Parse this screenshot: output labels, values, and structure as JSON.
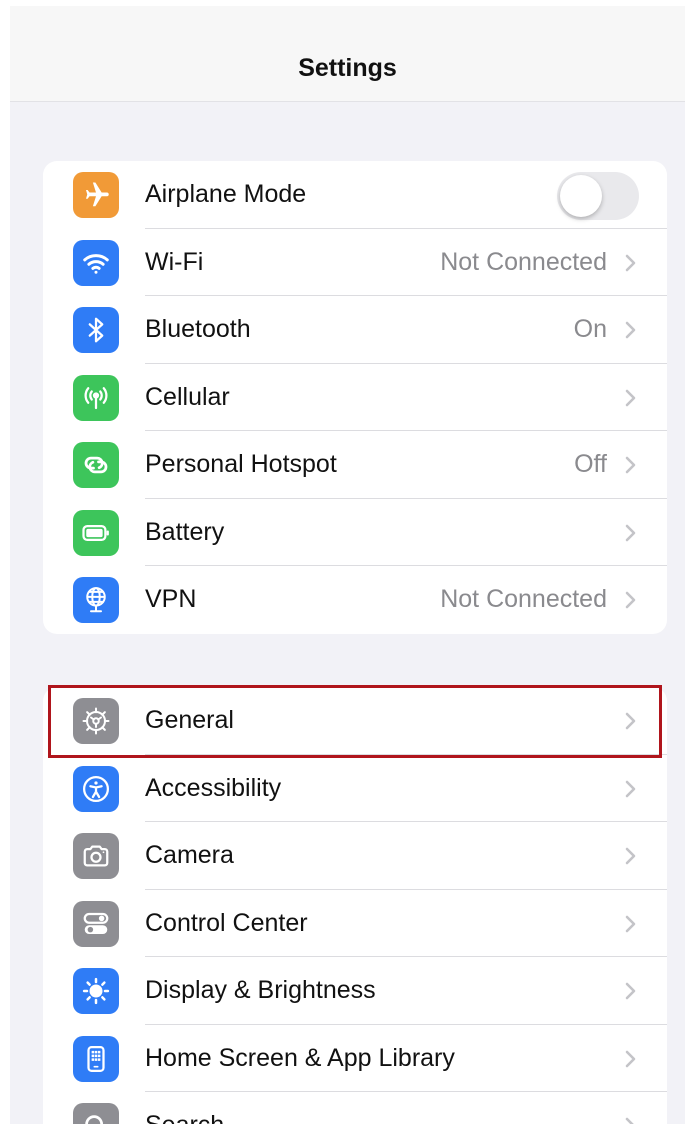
{
  "nav": {
    "title": "Settings"
  },
  "group1": [
    {
      "id": "airplane-mode",
      "label": "Airplane Mode",
      "value": "",
      "icon": "airplane-icon",
      "color": "#f19a37",
      "control": "toggle",
      "toggle_on": false
    },
    {
      "id": "wifi",
      "label": "Wi-Fi",
      "value": "Not Connected",
      "icon": "wifi-icon",
      "color": "#2f7cf6",
      "control": "chevron"
    },
    {
      "id": "bluetooth",
      "label": "Bluetooth",
      "value": "On",
      "icon": "bluetooth-icon",
      "color": "#2f7cf6",
      "control": "chevron"
    },
    {
      "id": "cellular",
      "label": "Cellular",
      "value": "",
      "icon": "antenna-icon",
      "color": "#3dc55b",
      "control": "chevron"
    },
    {
      "id": "personal-hotspot",
      "label": "Personal Hotspot",
      "value": "Off",
      "icon": "link-icon",
      "color": "#3dc55b",
      "control": "chevron"
    },
    {
      "id": "battery",
      "label": "Battery",
      "value": "",
      "icon": "battery-icon",
      "color": "#3dc55b",
      "control": "chevron"
    },
    {
      "id": "vpn",
      "label": "VPN",
      "value": "Not Connected",
      "icon": "globe-icon",
      "color": "#2f7cf6",
      "control": "chevron"
    }
  ],
  "group2": [
    {
      "id": "general",
      "label": "General",
      "value": "",
      "icon": "gear-icon",
      "color": "#8e8e93",
      "control": "chevron"
    },
    {
      "id": "accessibility",
      "label": "Accessibility",
      "value": "",
      "icon": "accessibility-icon",
      "color": "#2f7cf6",
      "control": "chevron"
    },
    {
      "id": "camera",
      "label": "Camera",
      "value": "",
      "icon": "camera-icon",
      "color": "#8e8e93",
      "control": "chevron"
    },
    {
      "id": "control-center",
      "label": "Control Center",
      "value": "",
      "icon": "switches-icon",
      "color": "#8e8e93",
      "control": "chevron"
    },
    {
      "id": "display-brightness",
      "label": "Display & Brightness",
      "value": "",
      "icon": "sun-icon",
      "color": "#2f7cf6",
      "control": "chevron"
    },
    {
      "id": "home-screen",
      "label": "Home Screen & App Library",
      "value": "",
      "icon": "phone-grid-icon",
      "color": "#2f7cf6",
      "control": "chevron"
    },
    {
      "id": "search",
      "label": "Search",
      "value": "",
      "icon": "search-icon",
      "color": "#8e8e93",
      "control": "chevron"
    }
  ],
  "highlight": {
    "target": "general",
    "color": "#b0151c"
  }
}
